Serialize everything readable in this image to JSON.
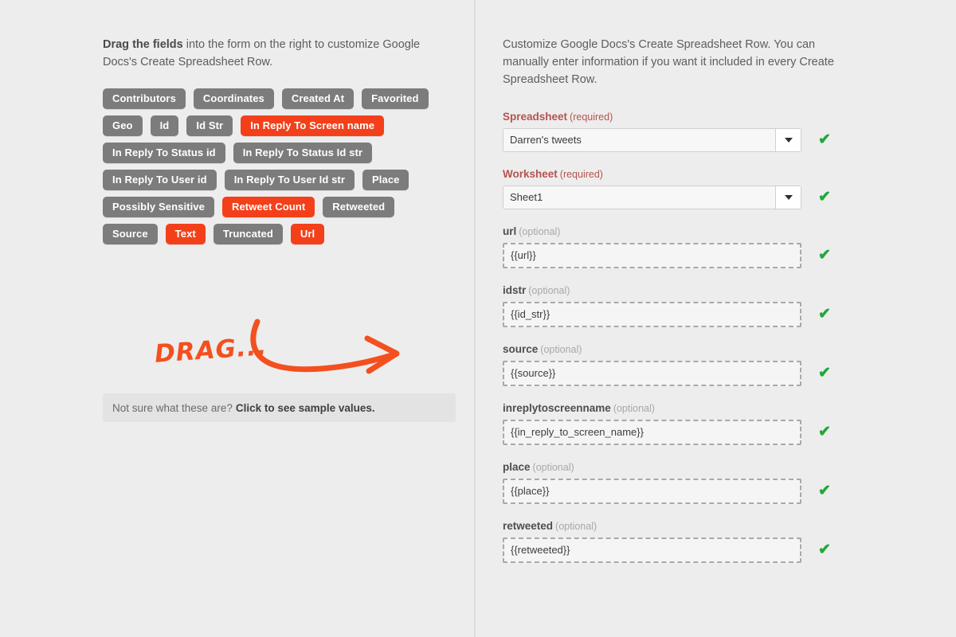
{
  "left": {
    "intro_bold": "Drag the fields",
    "intro_rest": " into the form on the right to customize Google Docs's Create Spreadsheet Row.",
    "tags": [
      {
        "label": "Contributors",
        "active": false
      },
      {
        "label": "Coordinates",
        "active": false
      },
      {
        "label": "Created At",
        "active": false
      },
      {
        "label": "Favorited",
        "active": false
      },
      {
        "label": "Geo",
        "active": false
      },
      {
        "label": "Id",
        "active": false
      },
      {
        "label": "Id Str",
        "active": false
      },
      {
        "label": "In Reply To Screen name",
        "active": true
      },
      {
        "label": "In Reply To Status id",
        "active": false
      },
      {
        "label": "In Reply To Status Id str",
        "active": false
      },
      {
        "label": "In Reply To User id",
        "active": false
      },
      {
        "label": "In Reply To User Id str",
        "active": false
      },
      {
        "label": "Place",
        "active": false
      },
      {
        "label": "Possibly Sensitive",
        "active": false
      },
      {
        "label": "Retweet Count",
        "active": true
      },
      {
        "label": "Retweeted",
        "active": false
      },
      {
        "label": "Source",
        "active": false
      },
      {
        "label": "Text",
        "active": true
      },
      {
        "label": "Truncated",
        "active": false
      },
      {
        "label": "Url",
        "active": true
      }
    ],
    "drag_annotation": "DRAG...",
    "sample_hint_text": "Not sure what these are?",
    "sample_hint_link": "Click to see sample values."
  },
  "right": {
    "intro": "Customize Google Docs's Create Spreadsheet Row. You can manually enter information if you want it included in every Create Spreadsheet Row.",
    "required_suffix": "(required)",
    "optional_suffix": "(optional)",
    "fields": [
      {
        "name": "Spreadsheet",
        "requirement": "required",
        "control": "select",
        "value": "Darren's tweets",
        "valid": true
      },
      {
        "name": "Worksheet",
        "requirement": "required",
        "control": "select",
        "value": "Sheet1",
        "valid": true
      },
      {
        "name": "url",
        "requirement": "optional",
        "control": "drop",
        "value": "{{url}}",
        "valid": true
      },
      {
        "name": "idstr",
        "requirement": "optional",
        "control": "drop",
        "value": "{{id_str}}",
        "valid": true
      },
      {
        "name": "source",
        "requirement": "optional",
        "control": "drop",
        "value": "{{source}}",
        "valid": true
      },
      {
        "name": "inreplytoscreenname",
        "requirement": "optional",
        "control": "drop",
        "value": "{{in_reply_to_screen_name}}",
        "valid": true
      },
      {
        "name": "place",
        "requirement": "optional",
        "control": "drop",
        "value": "{{place}}",
        "valid": true
      },
      {
        "name": "retweeted",
        "requirement": "optional",
        "control": "drop",
        "value": "{{retweeted}}",
        "valid": true
      }
    ],
    "valid_mark": "✔"
  },
  "colors": {
    "accent_orange": "#f4401a",
    "tag_gray": "#7c7c7c",
    "required_red": "#b3544f",
    "valid_green": "#22a83a",
    "page_background": "#ededed"
  }
}
